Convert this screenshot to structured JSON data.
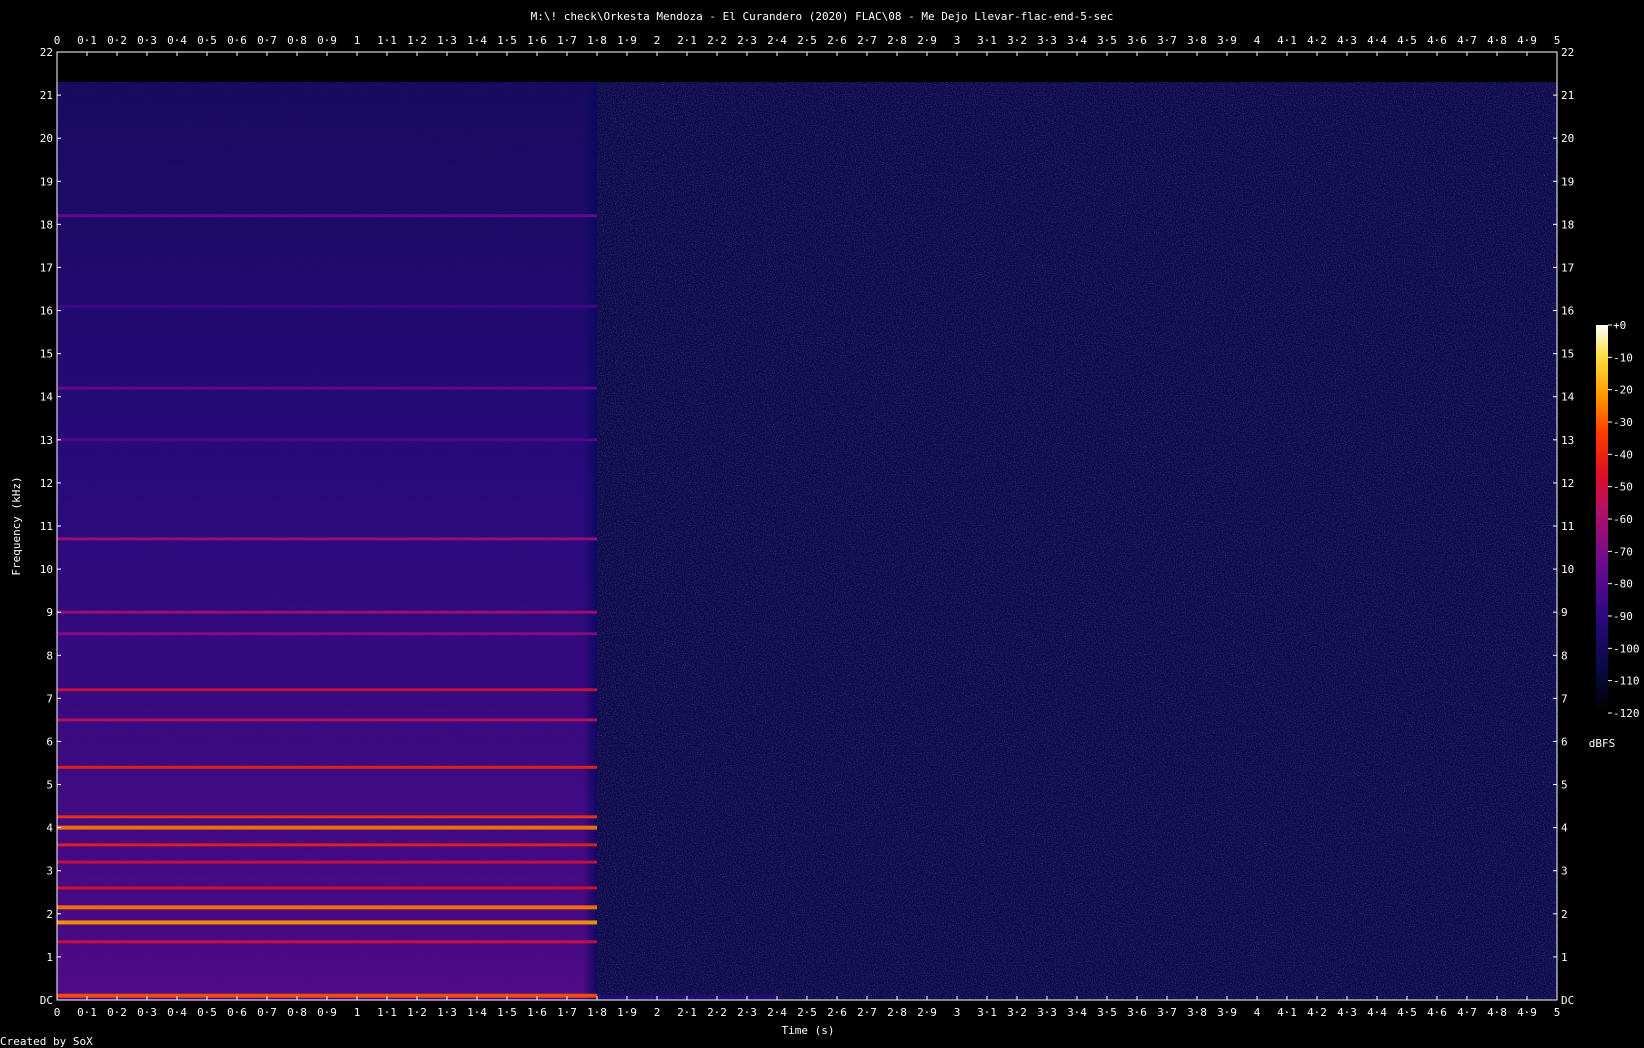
{
  "chart_data": {
    "type": "heatmap",
    "title": "M:\\! check\\Orkesta Mendoza - El Curandero (2020) FLAC\\08 - Me Dejo Llevar-flac-end-5-sec",
    "xlabel": "Time (s)",
    "ylabel": "Frequency (kHz)",
    "xlim": [
      0,
      5
    ],
    "ylim": [
      0,
      22
    ],
    "x_ticks": [
      "0",
      "0·1",
      "0·2",
      "0·3",
      "0·4",
      "0·5",
      "0·6",
      "0·7",
      "0·8",
      "0·9",
      "1",
      "1·1",
      "1·2",
      "1·3",
      "1·4",
      "1·5",
      "1·6",
      "1·7",
      "1·8",
      "1·9",
      "2",
      "2·1",
      "2·2",
      "2·3",
      "2·4",
      "2·5",
      "2·6",
      "2·7",
      "2·8",
      "2·9",
      "3",
      "3·1",
      "3·2",
      "3·3",
      "3·4",
      "3·5",
      "3·6",
      "3·7",
      "3·8",
      "3·9",
      "4",
      "4·1",
      "4·2",
      "4·3",
      "4·4",
      "4·5",
      "4·6",
      "4·7",
      "4·8",
      "4·9",
      "5"
    ],
    "y_ticks": [
      "DC",
      "1",
      "2",
      "3",
      "4",
      "5",
      "6",
      "7",
      "8",
      "9",
      "10",
      "11",
      "12",
      "13",
      "14",
      "15",
      "16",
      "17",
      "18",
      "19",
      "20",
      "21",
      "22"
    ],
    "colorbar": {
      "label": "dBFS",
      "range": [
        -120,
        0
      ],
      "ticks": [
        "+0",
        "-10",
        "-20",
        "-30",
        "-40",
        "-50",
        "-60",
        "-70",
        "-80",
        "-90",
        "-100",
        "-110",
        "-120"
      ]
    },
    "signal_end_time": 1.8,
    "noise_floor_dbfs": -110,
    "bands": [
      {
        "freq_khz": 0.1,
        "level_dbfs": -35
      },
      {
        "freq_khz": 1.35,
        "level_dbfs": -55
      },
      {
        "freq_khz": 1.8,
        "level_dbfs": -25
      },
      {
        "freq_khz": 2.15,
        "level_dbfs": -30
      },
      {
        "freq_khz": 2.6,
        "level_dbfs": -50
      },
      {
        "freq_khz": 3.2,
        "level_dbfs": -55
      },
      {
        "freq_khz": 3.6,
        "level_dbfs": -45
      },
      {
        "freq_khz": 4.0,
        "level_dbfs": -30
      },
      {
        "freq_khz": 4.25,
        "level_dbfs": -40
      },
      {
        "freq_khz": 5.4,
        "level_dbfs": -45
      },
      {
        "freq_khz": 6.5,
        "level_dbfs": -60
      },
      {
        "freq_khz": 7.2,
        "level_dbfs": -55
      },
      {
        "freq_khz": 8.5,
        "level_dbfs": -70
      },
      {
        "freq_khz": 9.0,
        "level_dbfs": -65
      },
      {
        "freq_khz": 10.7,
        "level_dbfs": -65
      },
      {
        "freq_khz": 13.0,
        "level_dbfs": -80
      },
      {
        "freq_khz": 14.2,
        "level_dbfs": -75
      },
      {
        "freq_khz": 16.1,
        "level_dbfs": -85
      },
      {
        "freq_khz": 18.2,
        "level_dbfs": -75
      }
    ]
  },
  "footer": {
    "credit": "Created by SoX"
  }
}
